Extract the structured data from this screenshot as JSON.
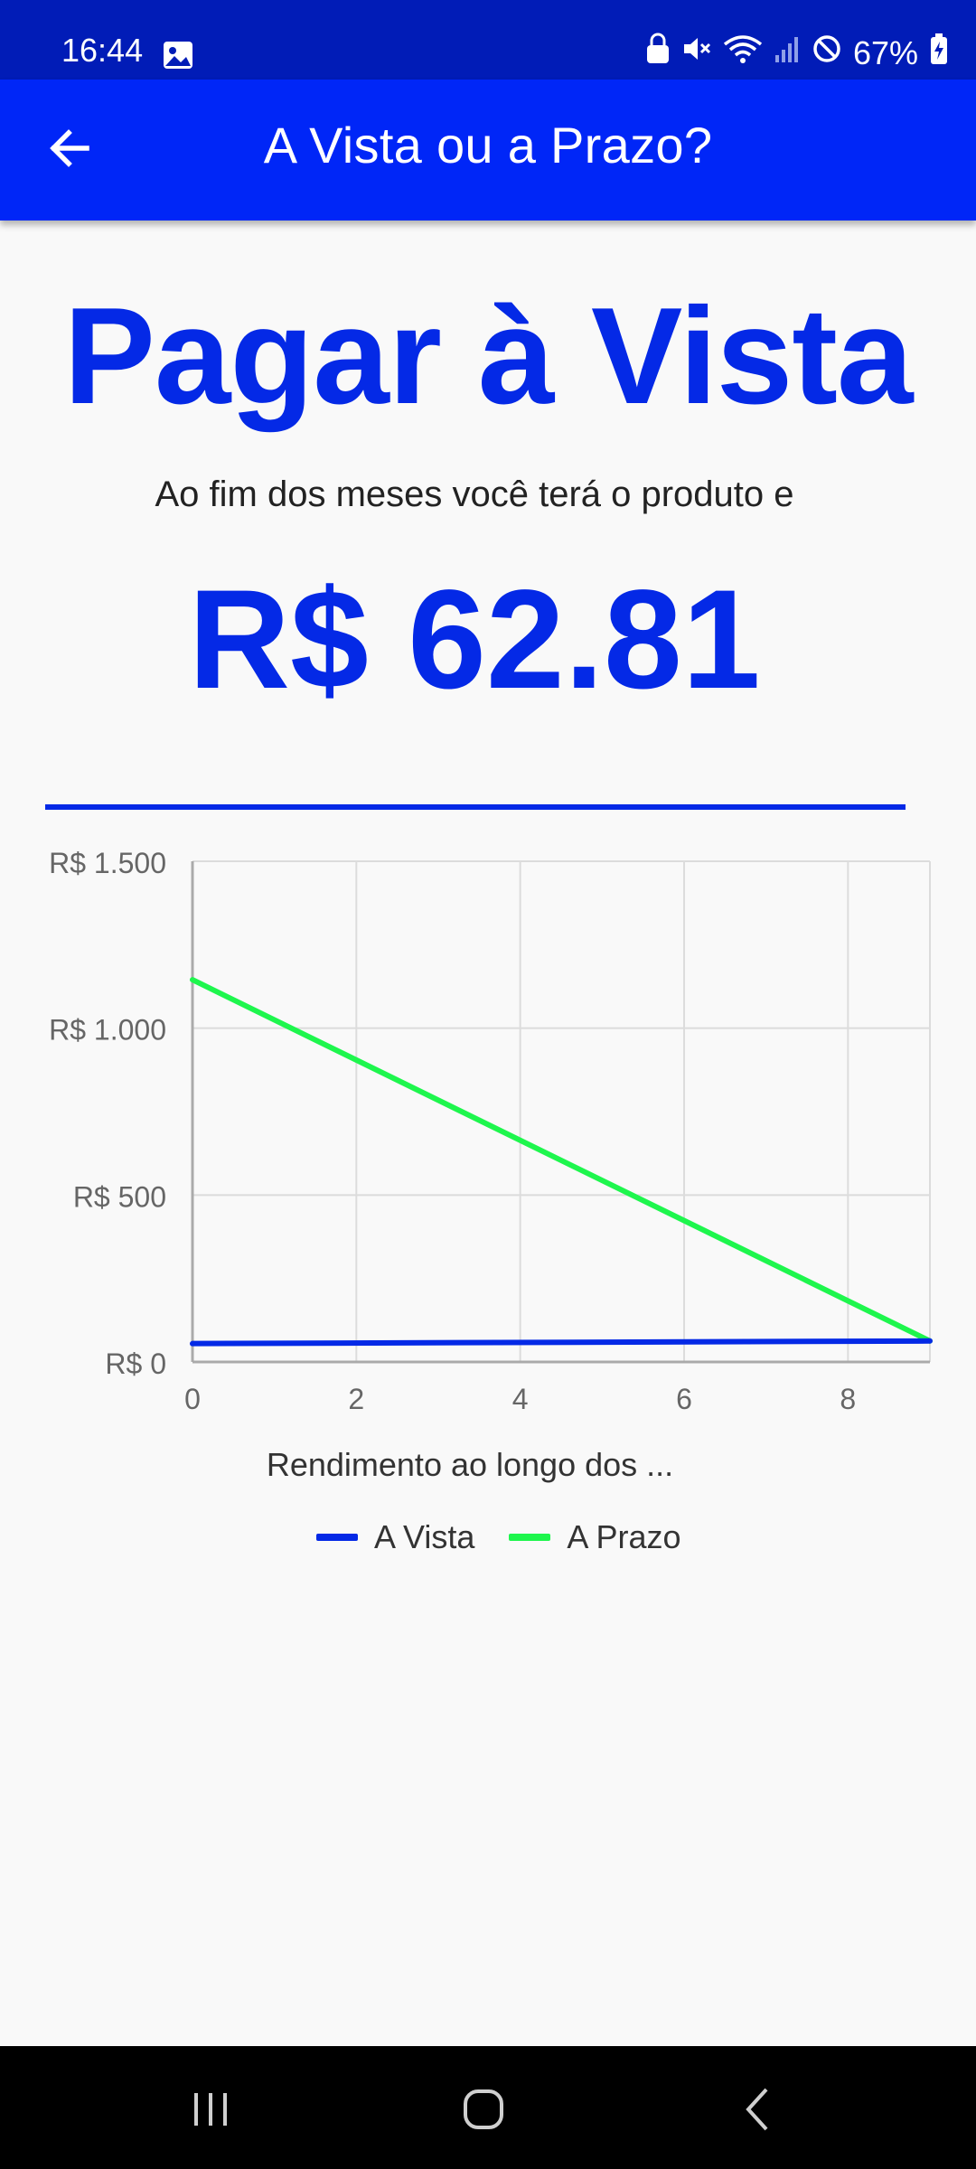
{
  "status": {
    "time": "16:44",
    "battery": "67%",
    "icons": [
      "gallery-icon",
      "lock-icon",
      "mute-icon",
      "wifi-icon",
      "signal-icon",
      "blocked-icon",
      "battery-icon"
    ]
  },
  "appbar": {
    "title": "A Vista ou a Prazo?",
    "back_icon": "arrow-back-icon"
  },
  "result": {
    "headline": "Pagar à Vista",
    "subtitle": "Ao fim dos meses você terá o produto e",
    "amount": "R$ 62.81"
  },
  "colors": {
    "accent": "#0429e6",
    "appbar": "#0026f7",
    "statusbar": "#011cb7",
    "series_vista": "#0429e6",
    "series_prazo": "#1ef64d"
  },
  "chart_data": {
    "type": "line",
    "x": [
      0,
      9
    ],
    "series": [
      {
        "name": "A Vista",
        "values": [
          55,
          62.81
        ]
      },
      {
        "name": "A Prazo",
        "values": [
          1145,
          62.81
        ]
      }
    ],
    "xticks": [
      "0",
      "2",
      "4",
      "6",
      "8"
    ],
    "xtick_values": [
      0,
      2,
      4,
      6,
      8
    ],
    "yticks": [
      "R$ 0",
      "R$ 500",
      "R$ 1.000",
      "R$ 1.500"
    ],
    "ytick_values": [
      0,
      500,
      1000,
      1500
    ],
    "xlim": [
      0,
      9
    ],
    "ylim": [
      0,
      1500
    ],
    "grid": true,
    "xlabel": "Rendimento ao longo dos ...",
    "legend_position": "bottom"
  },
  "nav": {
    "recent_icon": "recent-apps-icon",
    "home_icon": "home-icon",
    "back_icon": "back-icon"
  }
}
